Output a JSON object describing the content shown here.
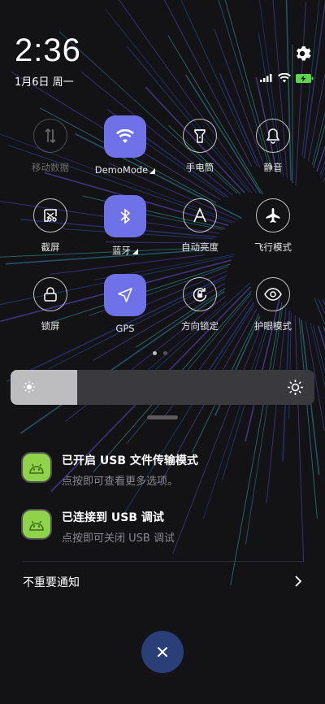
{
  "status_bar": {
    "time": "2:36",
    "date": "1月6日 周一",
    "icons": [
      "signal-icon",
      "wifi-icon",
      "battery-charging-icon"
    ]
  },
  "settings_icon": "gear-icon",
  "toggles": [
    {
      "label": "移动数据",
      "icon": "mobile-data-icon",
      "state": "disabled"
    },
    {
      "label": "DemoMode",
      "icon": "wifi-icon",
      "state": "active",
      "expandable": true
    },
    {
      "label": "手电筒",
      "icon": "flashlight-icon",
      "state": "off"
    },
    {
      "label": "静音",
      "icon": "bell-icon",
      "state": "off"
    },
    {
      "label": "截屏",
      "icon": "screenshot-icon",
      "state": "off"
    },
    {
      "label": "蓝牙",
      "icon": "bluetooth-icon",
      "state": "active",
      "expandable": true
    },
    {
      "label": "自动亮度",
      "icon": "auto-brightness-icon",
      "state": "off"
    },
    {
      "label": "飞行模式",
      "icon": "airplane-icon",
      "state": "off"
    },
    {
      "label": "锁屏",
      "icon": "lock-icon",
      "state": "off"
    },
    {
      "label": "GPS",
      "icon": "location-arrow-icon",
      "state": "active"
    },
    {
      "label": "方向锁定",
      "icon": "rotation-lock-icon",
      "state": "off"
    },
    {
      "label": "护眼模式",
      "icon": "eye-icon",
      "state": "off"
    }
  ],
  "pager": {
    "pages": 2,
    "current": 1
  },
  "brightness": {
    "level": 0.22,
    "icon_left": "sun-small-icon",
    "icon_right": "sun-large-icon"
  },
  "notifications": [
    {
      "title": "已开启 USB 文件传输模式",
      "subtitle": "点按即可查看更多选项。",
      "icon": "android-icon"
    },
    {
      "title": "已连接到 USB 调试",
      "subtitle": "点按即可关闭 USB 调试",
      "icon": "android-icon"
    }
  ],
  "unimportant": {
    "label": "不重要通知",
    "icon": "chevron-right-icon"
  },
  "clear_button": {
    "icon": "close-icon"
  },
  "colors": {
    "accent": "#6e71e8",
    "clear_button": "#2a3f78",
    "app_icon": "#8fd34b",
    "background": "#131316"
  }
}
